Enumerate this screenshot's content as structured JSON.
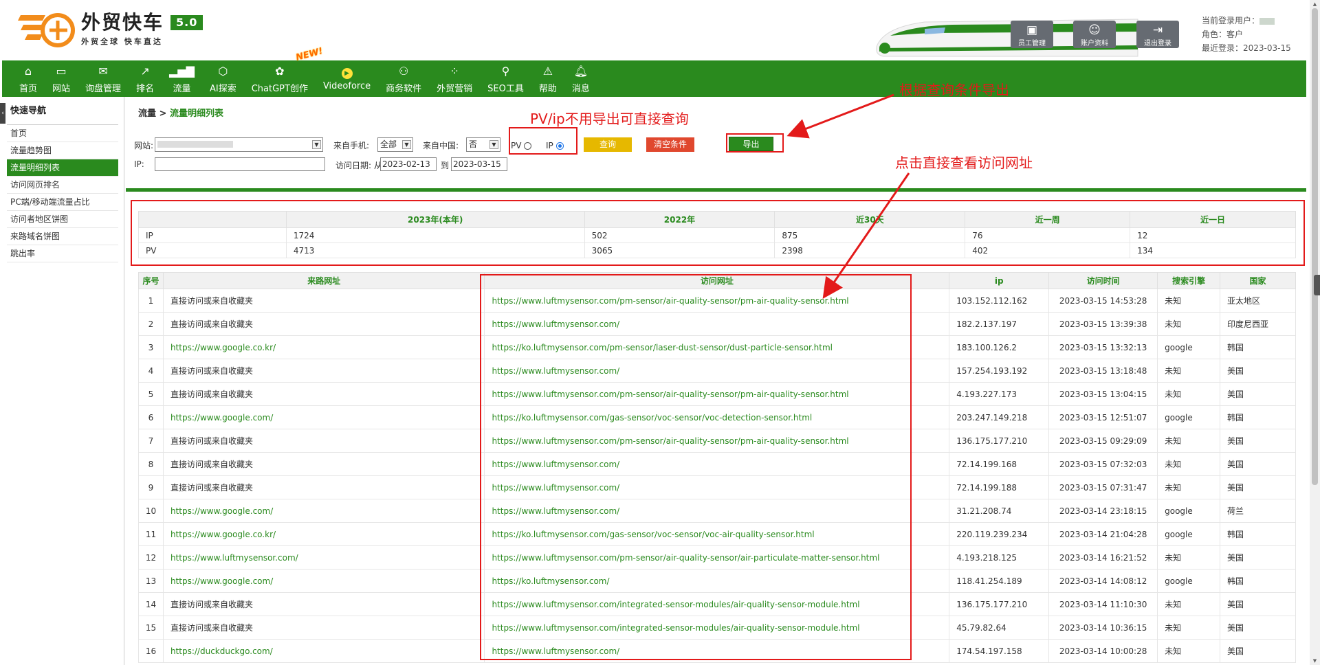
{
  "header": {
    "logo_title": "外贸快车",
    "version": "5.0",
    "slogan": "外贸全球 快车直达",
    "buttons": [
      {
        "label": "员工管理",
        "icon": "staff-icon"
      },
      {
        "label": "账户资料",
        "icon": "account-icon"
      },
      {
        "label": "退出登录",
        "icon": "logout-icon"
      }
    ],
    "user": {
      "current_label": "当前登录用户：",
      "role_label": "角色：",
      "role": "客户",
      "last_login_label": "最近登录：",
      "last_login": "2023-03-15"
    }
  },
  "nav": {
    "items": [
      {
        "label": "首页",
        "icon": "home-icon"
      },
      {
        "label": "网站",
        "icon": "monitor-icon"
      },
      {
        "label": "询盘管理",
        "icon": "mail-icon"
      },
      {
        "label": "排名",
        "icon": "ranking-icon"
      },
      {
        "label": "流量",
        "icon": "bar-chart-icon"
      },
      {
        "label": "AI探索",
        "icon": "ai-icon"
      },
      {
        "label": "ChatGPT创作",
        "icon": "chatgpt-icon"
      },
      {
        "label": "Videoforce",
        "icon": "video-icon"
      },
      {
        "label": "商务软件",
        "icon": "software-icon"
      },
      {
        "label": "外贸营销",
        "icon": "marketing-icon"
      },
      {
        "label": "SEO工具",
        "icon": "search-icon"
      },
      {
        "label": "帮助",
        "icon": "warning-icon"
      },
      {
        "label": "消息",
        "icon": "bell-icon"
      }
    ],
    "new_badge": "NEW!"
  },
  "sidebar": {
    "title": "快速导航",
    "items": [
      "首页",
      "流量趋势图",
      "流量明细列表",
      "访问网页排名",
      "PC端/移动端流量占比",
      "访问者地区饼图",
      "来路域名饼图",
      "跳出率"
    ],
    "active_index": 2
  },
  "breadcrumb": {
    "parent": "流量",
    "separator": " > ",
    "current": "流量明细列表"
  },
  "filters": {
    "site_label": "网站:",
    "mobile_label": "来自手机:",
    "mobile_value": "全部",
    "china_label": "来自中国:",
    "china_value": "否",
    "pv_label": "PV",
    "ip_label": "IP",
    "query_label": "查询",
    "clear_label": "清空条件",
    "export_label": "导出",
    "ip_field_label": "IP:",
    "date_label": "访问日期: 从",
    "date_from": "2023-02-13",
    "date_to_label": "到",
    "date_to": "2023-03-15"
  },
  "summary": {
    "headers": [
      "",
      "2023年(本年)",
      "2022年",
      "近30天",
      "近一周",
      "近一日"
    ],
    "rows": [
      [
        "IP",
        "1724",
        "502",
        "875",
        "76",
        "12"
      ],
      [
        "PV",
        "4713",
        "3065",
        "2398",
        "402",
        "134"
      ]
    ]
  },
  "detail": {
    "headers": [
      "序号",
      "来路网址",
      "访问网址",
      "ip",
      "访问时间",
      "搜索引擎",
      "国家"
    ],
    "rows": [
      [
        "1",
        "直接访问或来自收藏夹",
        "https://www.luftmysensor.com/pm-sensor/air-quality-sensor/pm-air-quality-sensor.html",
        "103.152.112.162",
        "2023-03-15 14:53:28",
        "未知",
        "亚太地区"
      ],
      [
        "2",
        "直接访问或来自收藏夹",
        "https://www.luftmysensor.com/",
        "182.2.137.197",
        "2023-03-15 13:39:38",
        "未知",
        "印度尼西亚"
      ],
      [
        "3",
        "https://www.google.co.kr/",
        "https://ko.luftmysensor.com/pm-sensor/laser-dust-sensor/dust-particle-sensor.html",
        "183.100.126.2",
        "2023-03-15 13:32:13",
        "google",
        "韩国"
      ],
      [
        "4",
        "直接访问或来自收藏夹",
        "https://www.luftmysensor.com/",
        "157.254.193.192",
        "2023-03-15 13:18:48",
        "未知",
        "美国"
      ],
      [
        "5",
        "直接访问或来自收藏夹",
        "https://www.luftmysensor.com/pm-sensor/air-quality-sensor/pm-air-quality-sensor.html",
        "4.193.227.173",
        "2023-03-15 13:04:15",
        "未知",
        "美国"
      ],
      [
        "6",
        "https://www.google.com/",
        "https://ko.luftmysensor.com/gas-sensor/voc-sensor/voc-detection-sensor.html",
        "203.247.149.218",
        "2023-03-15 12:51:07",
        "google",
        "韩国"
      ],
      [
        "7",
        "直接访问或来自收藏夹",
        "https://www.luftmysensor.com/pm-sensor/air-quality-sensor/pm-air-quality-sensor.html",
        "136.175.177.210",
        "2023-03-15 09:29:09",
        "未知",
        "美国"
      ],
      [
        "8",
        "直接访问或来自收藏夹",
        "https://www.luftmysensor.com/",
        "72.14.199.168",
        "2023-03-15 07:32:03",
        "未知",
        "美国"
      ],
      [
        "9",
        "直接访问或来自收藏夹",
        "https://www.luftmysensor.com/",
        "72.14.199.188",
        "2023-03-15 07:31:47",
        "未知",
        "美国"
      ],
      [
        "10",
        "https://www.google.com/",
        "https://www.luftmysensor.com/",
        "31.21.208.74",
        "2023-03-14 23:18:15",
        "google",
        "荷兰"
      ],
      [
        "11",
        "https://www.google.co.kr/",
        "https://ko.luftmysensor.com/gas-sensor/voc-sensor/voc-air-quality-sensor.html",
        "220.119.239.234",
        "2023-03-14 21:04:28",
        "google",
        "韩国"
      ],
      [
        "12",
        "https://www.luftmysensor.com/",
        "https://www.luftmysensor.com/pm-sensor/air-quality-sensor/air-particulate-matter-sensor.html",
        "4.193.218.125",
        "2023-03-14 16:21:52",
        "未知",
        "美国"
      ],
      [
        "13",
        "https://www.google.com/",
        "https://ko.luftmysensor.com/",
        "118.41.254.189",
        "2023-03-14 14:08:12",
        "google",
        "韩国"
      ],
      [
        "14",
        "直接访问或来自收藏夹",
        "https://www.luftmysensor.com/integrated-sensor-modules/air-quality-sensor-module.html",
        "136.175.177.210",
        "2023-03-14 11:10:30",
        "未知",
        "美国"
      ],
      [
        "15",
        "直接访问或来自收藏夹",
        "https://www.luftmysensor.com/integrated-sensor-modules/air-quality-sensor-module.html",
        "45.79.82.64",
        "2023-03-14 10:36:15",
        "未知",
        "美国"
      ],
      [
        "16",
        "https://duckduckgo.com/",
        "https://www.luftmysensor.com/",
        "174.54.197.158",
        "2023-03-14 10:00:28",
        "未知",
        "美国"
      ]
    ]
  },
  "annotations": {
    "pv_ip": "PV/ip不用导出可直接查询",
    "export": "根据查询条件导出",
    "view_url": "点击直接查看访问网址"
  },
  "colors": {
    "brand_green": "#2a8a1e",
    "annotation_red": "#e31a1a",
    "query_yellow": "#e6b800",
    "clear_red": "#e0482e"
  }
}
